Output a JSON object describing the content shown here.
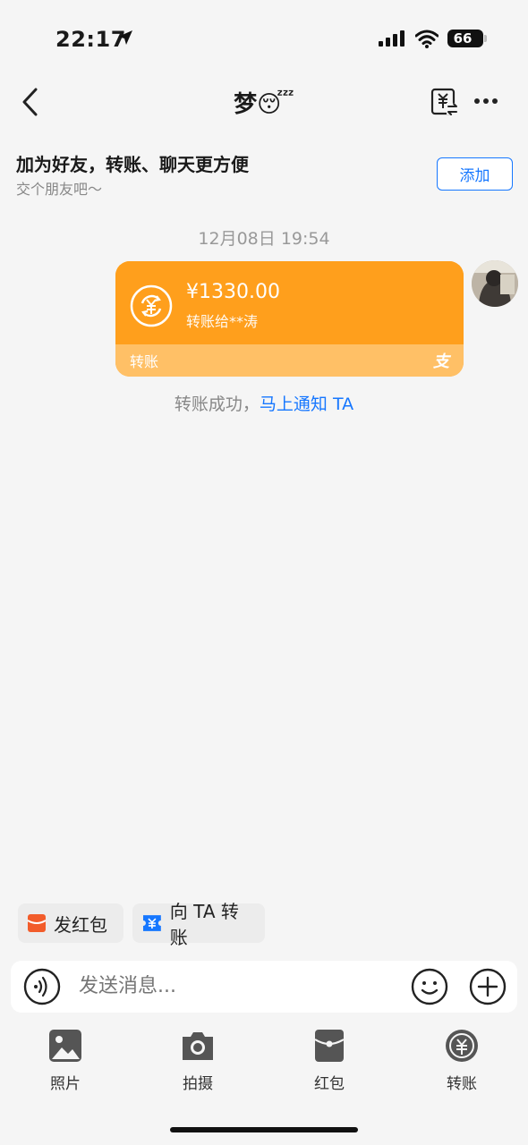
{
  "status_bar": {
    "time": "22:17",
    "battery": "66"
  },
  "nav": {
    "title": "梦😴"
  },
  "banner": {
    "title": "加为好友，转账、聊天更方便",
    "subtitle": "交个朋友吧～",
    "add_label": "添加"
  },
  "chat": {
    "timestamp": "12月08日 19:54",
    "transfer": {
      "amount": "¥1330.00",
      "recipient": "转账给**涛",
      "type_label": "转账",
      "brand_mark": "支"
    },
    "success_text": "转账成功，",
    "notify_link": "马上通知 TA"
  },
  "quick_actions": [
    {
      "label": "发红包"
    },
    {
      "label": "向 TA 转账"
    }
  ],
  "input": {
    "placeholder": "发送消息..."
  },
  "panel": [
    {
      "label": "照片"
    },
    {
      "label": "拍摄"
    },
    {
      "label": "红包"
    },
    {
      "label": "转账"
    }
  ],
  "colors": {
    "accent_blue": "#1677ff",
    "transfer_orange": "#ff9f1c",
    "transfer_orange_light": "#ffc066",
    "redpacket": "#f25c2a"
  }
}
